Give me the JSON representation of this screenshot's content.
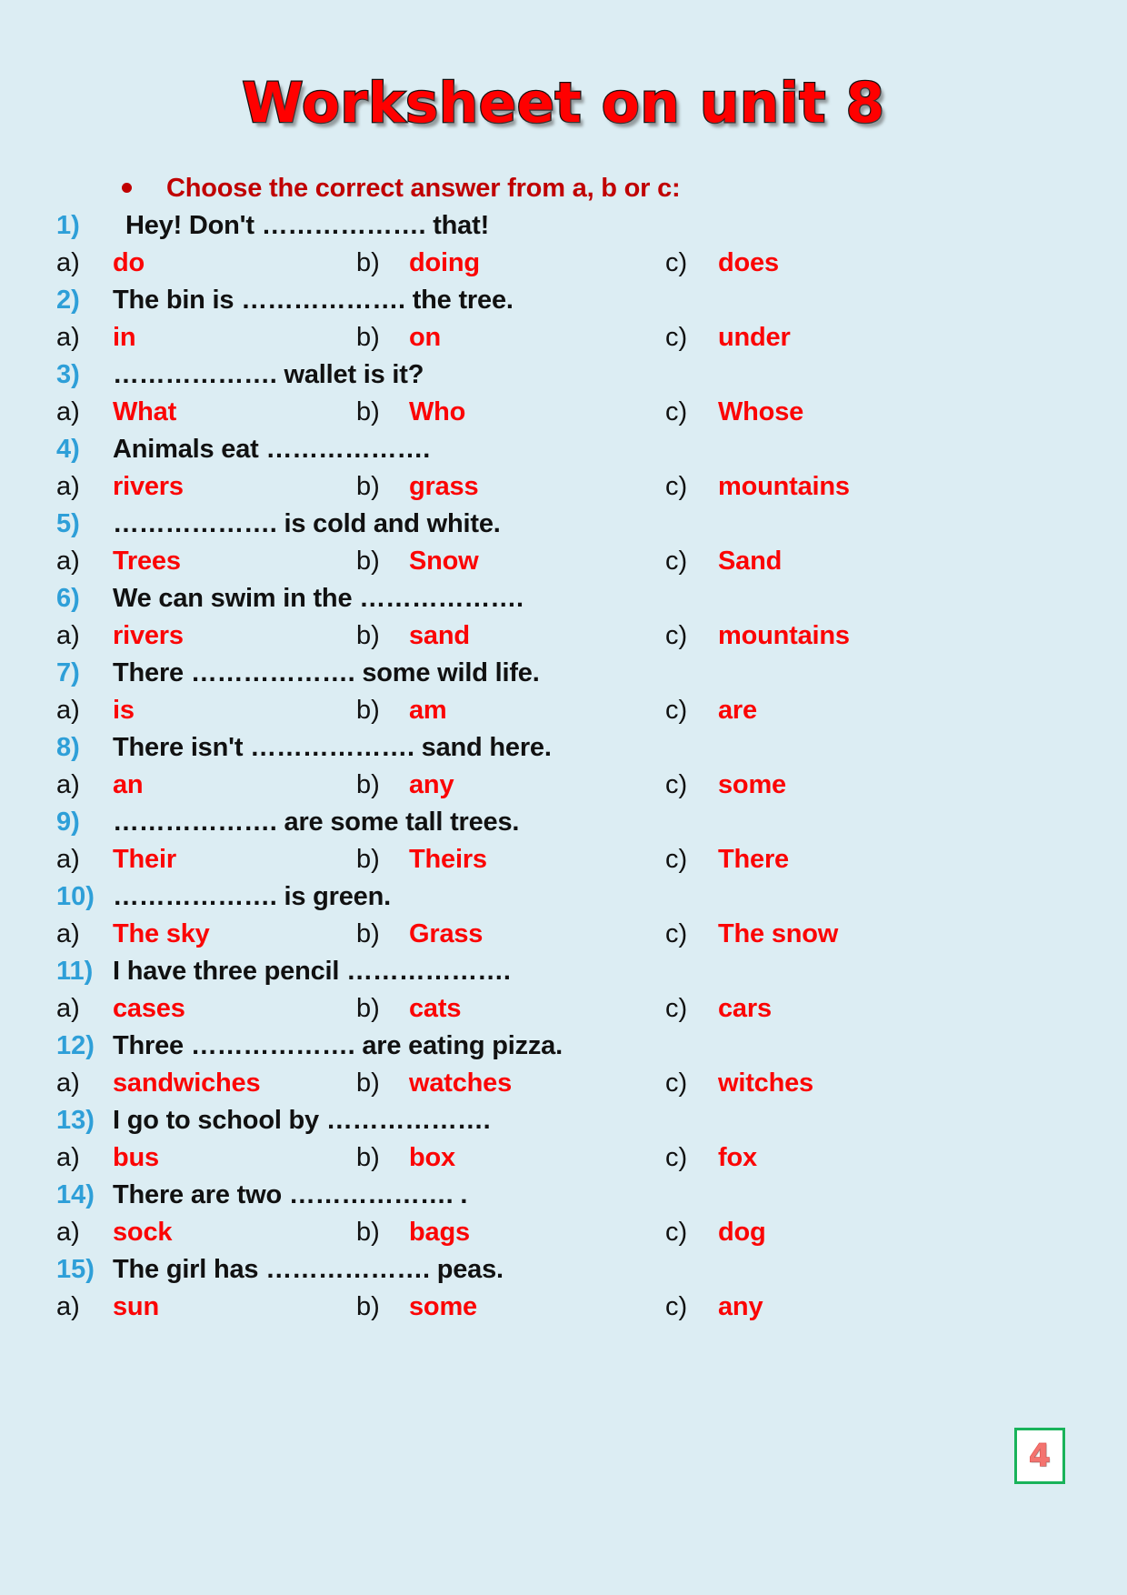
{
  "document": {
    "title": "Worksheet on unit 8",
    "background_color": "#dcedf3",
    "title_color": "#ff0000",
    "instruction_color": "#c00000",
    "question_number_color": "#2e9fd8",
    "option_text_color": "#fb0505"
  },
  "instruction": {
    "bullet": "bullet-dot",
    "text": "Choose the correct answer from a, b or c:"
  },
  "questions": [
    {
      "number": "1)",
      "text": "Hey! Don't ………………. that!",
      "options": [
        {
          "letter": "a)",
          "text": "do"
        },
        {
          "letter": "b)",
          "text": "doing"
        },
        {
          "letter": "c)",
          "text": "does"
        }
      ]
    },
    {
      "number": "2)",
      "text": "The bin is ………………. the tree.",
      "options": [
        {
          "letter": "a)",
          "text": "in"
        },
        {
          "letter": "b)",
          "text": "on"
        },
        {
          "letter": "c)",
          "text": "under"
        }
      ]
    },
    {
      "number": "3)",
      "text": "………………. wallet is it?",
      "options": [
        {
          "letter": "a)",
          "text": "What"
        },
        {
          "letter": "b)",
          "text": "Who"
        },
        {
          "letter": "c)",
          "text": "Whose"
        }
      ]
    },
    {
      "number": "4)",
      "text": "Animals eat ……………….",
      "options": [
        {
          "letter": "a)",
          "text": "rivers"
        },
        {
          "letter": "b)",
          "text": "grass"
        },
        {
          "letter": "c)",
          "text": "mountains"
        }
      ]
    },
    {
      "number": "5)",
      "text": "………………. is cold and white.",
      "options": [
        {
          "letter": "a)",
          "text": "Trees"
        },
        {
          "letter": "b)",
          "text": "Snow"
        },
        {
          "letter": "c)",
          "text": "Sand"
        }
      ]
    },
    {
      "number": "6)",
      "text": "We can swim in the ……………….",
      "options": [
        {
          "letter": "a)",
          "text": "rivers"
        },
        {
          "letter": "b)",
          "text": "sand"
        },
        {
          "letter": "c)",
          "text": "mountains"
        }
      ]
    },
    {
      "number": "7)",
      "text": "There ………………. some wild life.",
      "options": [
        {
          "letter": "a)",
          "text": "is"
        },
        {
          "letter": "b)",
          "text": "am"
        },
        {
          "letter": "c)",
          "text": "are"
        }
      ]
    },
    {
      "number": "8)",
      "text": "There isn't ………………. sand here.",
      "options": [
        {
          "letter": "a)",
          "text": "an"
        },
        {
          "letter": "b)",
          "text": "any"
        },
        {
          "letter": "c)",
          "text": "some"
        }
      ]
    },
    {
      "number": "9)",
      "text": "………………. are some tall trees.",
      "options": [
        {
          "letter": "a)",
          "text": "Their"
        },
        {
          "letter": "b)",
          "text": "Theirs"
        },
        {
          "letter": "c)",
          "text": "There"
        }
      ]
    },
    {
      "number": "10)",
      "text": "………………. is green.",
      "options": [
        {
          "letter": "a)",
          "text": "The sky"
        },
        {
          "letter": "b)",
          "text": "Grass"
        },
        {
          "letter": "c)",
          "text": "The snow"
        }
      ]
    },
    {
      "number": "11)",
      "text": "I have three pencil ……………….",
      "options": [
        {
          "letter": "a)",
          "text": "cases"
        },
        {
          "letter": "b)",
          "text": "cats"
        },
        {
          "letter": "c)",
          "text": "cars"
        }
      ]
    },
    {
      "number": "12)",
      "text": "Three ………………. are eating pizza.",
      "options": [
        {
          "letter": "a)",
          "text": "sandwiches"
        },
        {
          "letter": "b)",
          "text": "watches"
        },
        {
          "letter": "c)",
          "text": "witches"
        }
      ]
    },
    {
      "number": "13)",
      "text": "I go to school by ……………….",
      "options": [
        {
          "letter": "a)",
          "text": "bus"
        },
        {
          "letter": "b)",
          "text": "box"
        },
        {
          "letter": "c)",
          "text": "fox"
        }
      ]
    },
    {
      "number": "14)",
      "text": "There are two ………………. .",
      "options": [
        {
          "letter": "a)",
          "text": "sock"
        },
        {
          "letter": "b)",
          "text": "bags"
        },
        {
          "letter": "c)",
          "text": "dog"
        }
      ]
    },
    {
      "number": "15)",
      "text": "The girl has ………………. peas.",
      "options": [
        {
          "letter": "a)",
          "text": "sun"
        },
        {
          "letter": "b)",
          "text": "some"
        },
        {
          "letter": "c)",
          "text": "any"
        }
      ]
    }
  ],
  "page_badge": {
    "number": "4",
    "border_color": "#19b35a",
    "number_color": "#f4736f"
  }
}
